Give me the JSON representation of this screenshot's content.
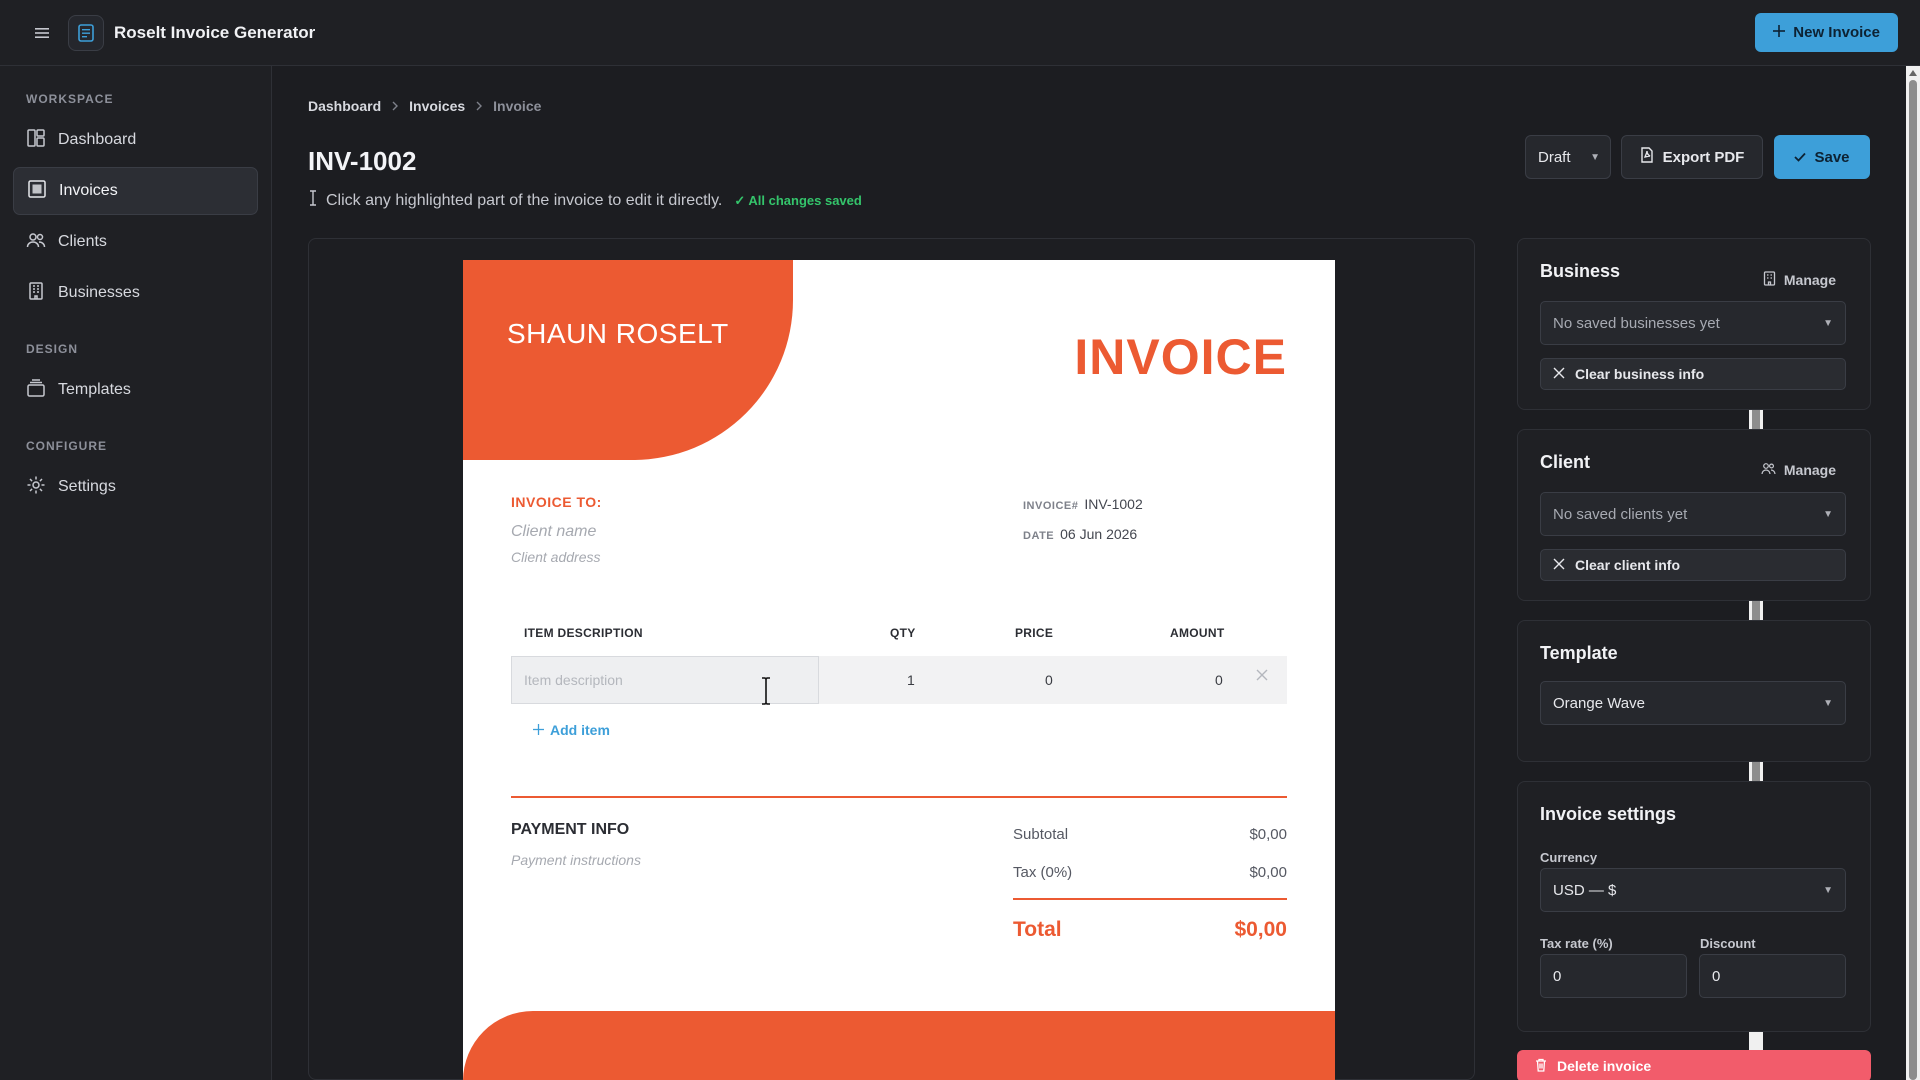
{
  "app": {
    "title": "Roselt Invoice Generator",
    "new_invoice_label": "New Invoice"
  },
  "sidebar": {
    "sections": [
      {
        "title": "WORKSPACE",
        "items": [
          {
            "label": "Dashboard",
            "icon": "dashboard-icon"
          },
          {
            "label": "Invoices",
            "icon": "invoice-icon",
            "active": true
          },
          {
            "label": "Clients",
            "icon": "users-icon"
          },
          {
            "label": "Businesses",
            "icon": "building-icon"
          }
        ]
      },
      {
        "title": "DESIGN",
        "items": [
          {
            "label": "Templates",
            "icon": "layers-icon"
          }
        ]
      },
      {
        "title": "CONFIGURE",
        "items": [
          {
            "label": "Settings",
            "icon": "gear-icon"
          }
        ]
      }
    ]
  },
  "breadcrumb": [
    "Dashboard",
    "Invoices",
    "Invoice"
  ],
  "page": {
    "title": "INV-1002",
    "hint": "Click any highlighted part of the invoice to edit it directly.",
    "saved_status": "✓ All changes saved",
    "status_value": "Draft",
    "export_label": "Export PDF",
    "save_label": "Save"
  },
  "invoice": {
    "business_name": "SHAUN ROSELT",
    "heading": "INVOICE",
    "to_label": "INVOICE TO:",
    "client_name_placeholder": "Client name",
    "client_address_placeholder": "Client address",
    "number_label": "INVOICE#",
    "number": "INV-1002",
    "date_label": "DATE",
    "date": "06 Jun 2026",
    "columns": {
      "description": "ITEM DESCRIPTION",
      "qty": "QTY",
      "price": "PRICE",
      "amount": "AMOUNT"
    },
    "items": [
      {
        "description_placeholder": "Item description",
        "qty": "1",
        "price": "0",
        "amount": "0"
      }
    ],
    "add_item_label": "Add item",
    "payment_label": "PAYMENT INFO",
    "payment_placeholder": "Payment instructions",
    "subtotal_label": "Subtotal",
    "subtotal": "$0,00",
    "tax_label": "Tax (0%)",
    "tax": "$0,00",
    "total_label": "Total",
    "total": "$0,00",
    "accent_color": "#ec5a32"
  },
  "panels": {
    "business": {
      "title": "Business",
      "manage_label": "Manage",
      "select_value": "No saved businesses yet",
      "clear_label": "Clear business info"
    },
    "client": {
      "title": "Client",
      "manage_label": "Manage",
      "select_value": "No saved clients yet",
      "clear_label": "Clear client info"
    },
    "template": {
      "title": "Template",
      "select_value": "Orange Wave"
    },
    "settings": {
      "title": "Invoice settings",
      "currency_label": "Currency",
      "currency_value": "USD — $",
      "tax_label": "Tax rate (%)",
      "tax_value": "0",
      "discount_label": "Discount",
      "discount_value": "0"
    },
    "delete_label": "Delete invoice"
  },
  "colors": {
    "primary": "#3d9fd9",
    "success": "#34c46b",
    "danger": "#f25c6b"
  }
}
